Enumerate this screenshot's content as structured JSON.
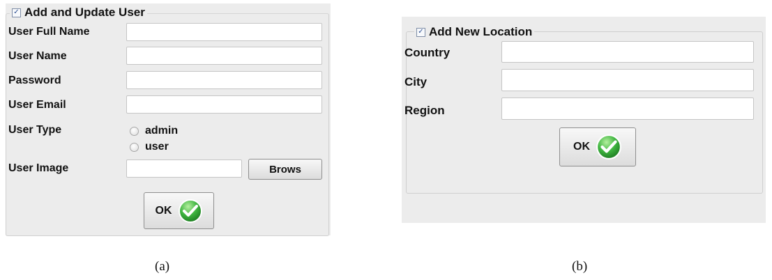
{
  "form_a": {
    "title": "Add and Update User",
    "checked": true,
    "fields": [
      {
        "label": "User Full Name",
        "value": ""
      },
      {
        "label": "User Name",
        "value": ""
      },
      {
        "label": "Password",
        "value": ""
      },
      {
        "label": "User Email",
        "value": ""
      }
    ],
    "user_type": {
      "label": "User Type",
      "options": [
        "admin",
        "user"
      ]
    },
    "user_image": {
      "label": "User Image",
      "value": "",
      "browse_label": "Brows"
    },
    "ok_label": "OK",
    "caption": "(a)"
  },
  "form_b": {
    "title": "Add New Location",
    "checked": true,
    "fields": [
      {
        "label": "Country",
        "value": ""
      },
      {
        "label": "City",
        "value": ""
      },
      {
        "label": "Region",
        "value": ""
      }
    ],
    "ok_label": "OK",
    "caption": "(b)"
  },
  "colors": {
    "panel_bg": "#ececec",
    "ok_check_green": "#3fb540"
  },
  "icons": [
    "checkbox-checked-icon",
    "radio-icon",
    "green-checkmark-icon"
  ]
}
